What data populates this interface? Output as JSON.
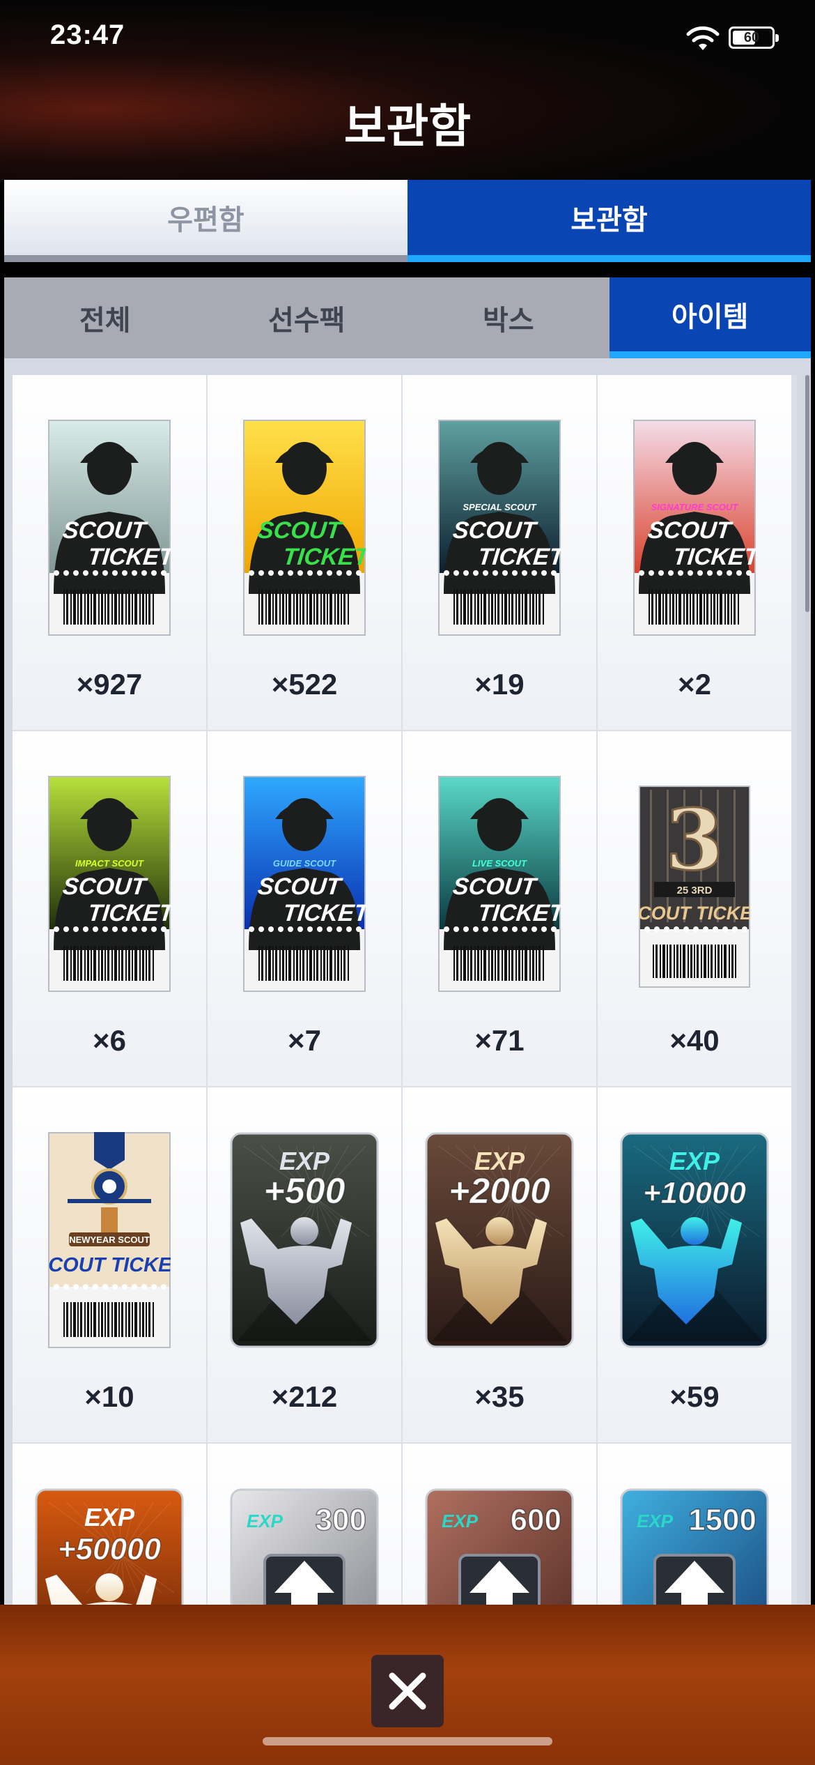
{
  "status": {
    "time": "23:47",
    "battery_level": "60",
    "battery_fraction": 0.6
  },
  "header": {
    "title": "보관함"
  },
  "top_tabs": [
    {
      "label": "우편함",
      "active": false
    },
    {
      "label": "보관함",
      "active": true
    }
  ],
  "sub_tabs": [
    {
      "label": "전체",
      "active": false
    },
    {
      "label": "선수팩",
      "active": false
    },
    {
      "label": "박스",
      "active": false
    },
    {
      "label": "아이템",
      "active": true
    }
  ],
  "items": [
    {
      "kind": "scout",
      "name": "scout-ticket-basic",
      "line1": "SCOUT",
      "line2": "TICKET",
      "tag": "",
      "bg1": "#d8ebe8",
      "bg2": "#7f9795",
      "count": "×927"
    },
    {
      "kind": "scout",
      "name": "scout-ticket-gold",
      "line1": "SCOUT",
      "line2": "TICKET",
      "tag": "",
      "bg1": "#ffe04a",
      "bg2": "#f0a500",
      "textColor": "#39e04b",
      "count": "×522"
    },
    {
      "kind": "scout",
      "name": "scout-ticket-special",
      "line1": "SCOUT",
      "line2": "TICKET",
      "tag": "SPECIAL SCOUT",
      "bg1": "#5fa0a0",
      "bg2": "#0c2030",
      "count": "×19"
    },
    {
      "kind": "scout",
      "name": "scout-ticket-signature",
      "line1": "SCOUT",
      "line2": "TICKET",
      "tag": "SIGNATURE SCOUT",
      "tagColor": "#ff3bd0",
      "bg1": "#f4dce8",
      "bg2": "#d9432e",
      "count": "×2"
    },
    {
      "kind": "scout",
      "name": "scout-ticket-impact",
      "line1": "SCOUT",
      "line2": "TICKET",
      "tag": "IMPACT SCOUT",
      "tagColor": "#d8ff2a",
      "bg1": "#b6e03a",
      "bg2": "#20300a",
      "count": "×6"
    },
    {
      "kind": "scout",
      "name": "scout-ticket-guide",
      "line1": "SCOUT",
      "line2": "TICKET",
      "tag": "GUIDE SCOUT",
      "tagColor": "#7fd8ff",
      "bg1": "#2fa8ff",
      "bg2": "#0a2fb0",
      "count": "×7"
    },
    {
      "kind": "scout",
      "name": "scout-ticket-live",
      "line1": "SCOUT",
      "line2": "TICKET",
      "tag": "LIVE SCOUT",
      "tagColor": "#44ffd8",
      "bg1": "#5ad8c8",
      "bg2": "#0a3a40",
      "count": "×71"
    },
    {
      "kind": "scout3",
      "name": "scout-ticket-25-3rd",
      "big": "3",
      "tag": "25 3RD",
      "line1": "SCOUT TICKET",
      "count": "×40"
    },
    {
      "kind": "scoutny",
      "name": "scout-ticket-newyear",
      "tag": "NEWYEAR SCOUT",
      "line1": "SCOUT TICKET",
      "count": "×10"
    },
    {
      "kind": "exp",
      "name": "exp-card-500",
      "label": "EXP",
      "value": "+500",
      "bg1": "#4a5046",
      "bg2": "#1a1d1a",
      "fig1": "#e0e4ea",
      "fig2": "#8a90a0",
      "count": "×212"
    },
    {
      "kind": "exp",
      "name": "exp-card-2000",
      "label": "EXP",
      "value": "+2000",
      "bg1": "#6a4a3a",
      "bg2": "#2a1a16",
      "fig1": "#f4e2b8",
      "fig2": "#b8905a",
      "count": "×35"
    },
    {
      "kind": "exp",
      "name": "exp-card-10000",
      "label": "EXP",
      "value": "+10000",
      "bg1": "#1a6a80",
      "bg2": "#0a1a2a",
      "fig1": "#40f0e8",
      "fig2": "#2070e0",
      "count": "×59"
    },
    {
      "kind": "exp",
      "name": "exp-card-50000",
      "label": "EXP",
      "value": "+50000",
      "bg1": "#d85a10",
      "bg2": "#4a1606",
      "fig1": "#ffffff",
      "fig2": "#f0d8b0",
      "count": ""
    },
    {
      "kind": "expup",
      "name": "exp-up-300",
      "label": "EXP",
      "value": "300",
      "bg1": "#e8e8ea",
      "bg2": "#8a8c92",
      "count": ""
    },
    {
      "kind": "expup",
      "name": "exp-up-600",
      "label": "EXP",
      "value": "600",
      "bg1": "#b07060",
      "bg2": "#5a3028",
      "count": ""
    },
    {
      "kind": "expup",
      "name": "exp-up-1500",
      "label": "EXP",
      "value": "1500",
      "bg1": "#40b0e0",
      "bg2": "#1a4a80",
      "count": ""
    }
  ]
}
